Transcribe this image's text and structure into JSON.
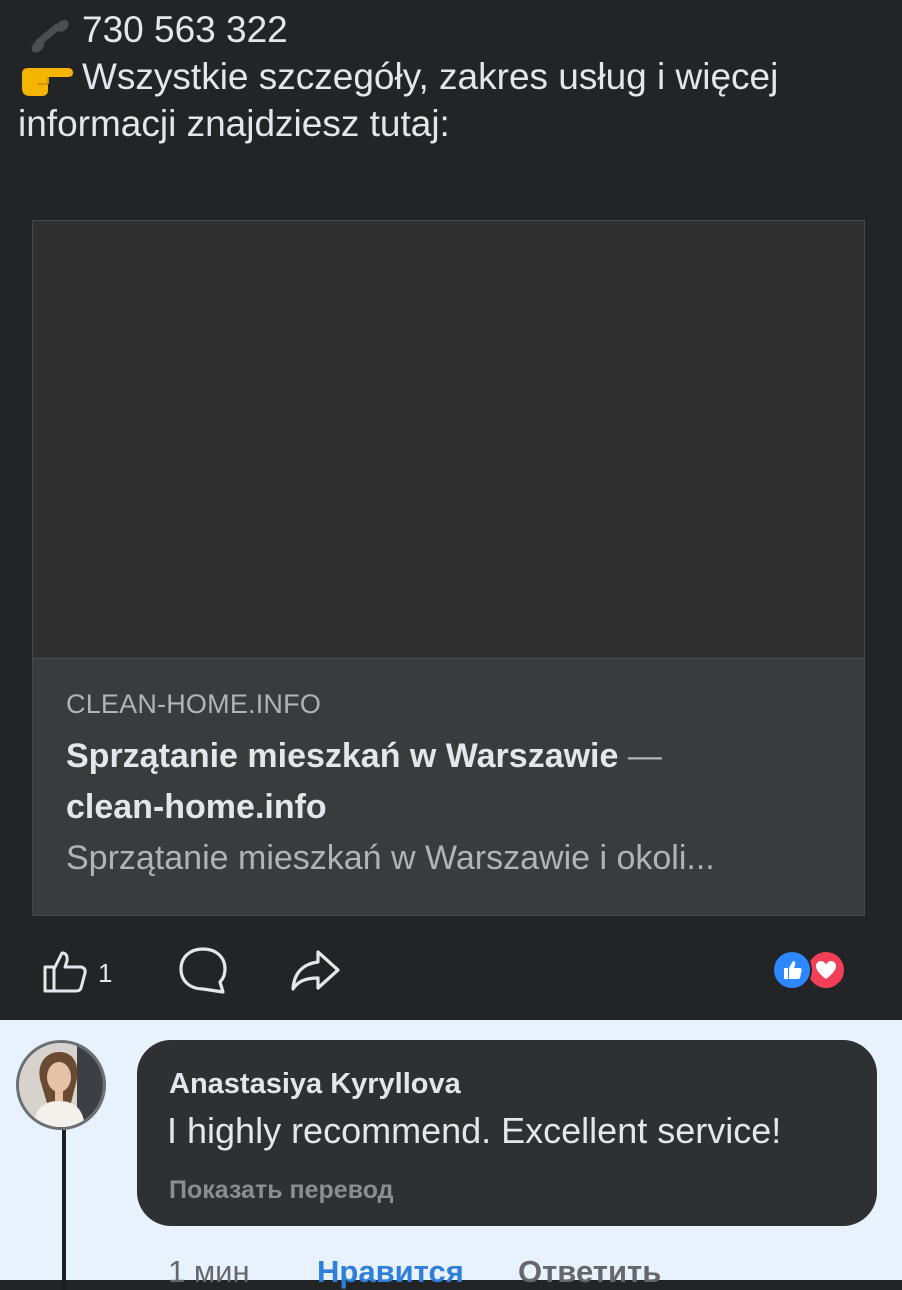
{
  "post": {
    "phone": "730 563 322",
    "info_line1": "Wszystkie szczegóły, zakres usług i więcej",
    "info_line2": "informacji znajdziesz tutaj:",
    "phone_icon": "telephone-receiver-icon",
    "pointer_icon": "backhand-index-pointing-right-icon"
  },
  "link_card": {
    "domain": "CLEAN-HOME.INFO",
    "title_main": "Sprzątanie mieszkań w Warszawie",
    "title_sep": " — ",
    "title_site": "clean-home.info",
    "description": "Sprzątanie mieszkań w Warszawie i okoli..."
  },
  "actions": {
    "like_count": "1",
    "icons": [
      "like-icon",
      "comment-icon",
      "share-icon"
    ],
    "reactions": [
      "like-reaction-icon",
      "love-reaction-icon"
    ]
  },
  "comment": {
    "author": "Anastasiya Kyryllova",
    "text": "I highly recommend. Excellent service!",
    "translate": "Показать перевод",
    "time": "1 мин",
    "like": "Нравится",
    "reply": "Ответить"
  },
  "colors": {
    "background": "#232425",
    "card": "#3a3b3c",
    "comment_area": "#e8f2fd",
    "link_blue": "#2e7fdb",
    "like_reaction": "#2d88ff",
    "love_reaction": "#f33e58"
  }
}
